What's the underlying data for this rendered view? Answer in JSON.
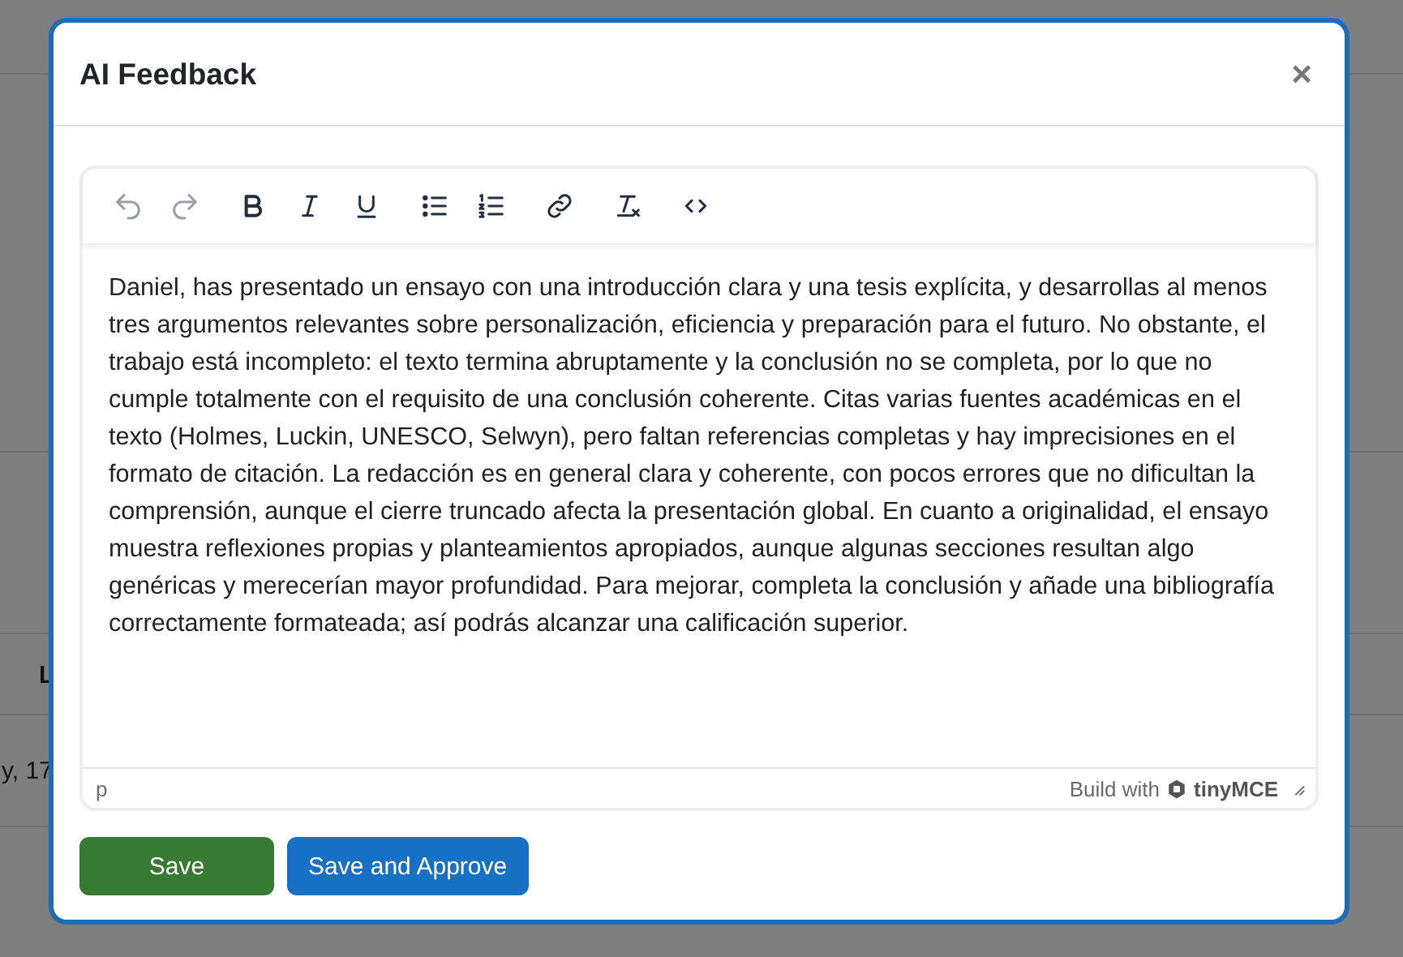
{
  "background": {
    "texts": [
      {
        "kind": "header",
        "text": "L"
      },
      {
        "kind": "cell",
        "text": "y, 17"
      }
    ]
  },
  "dialog": {
    "title": "AI Feedback",
    "close": "×"
  },
  "editor": {
    "toolbar": [
      {
        "kind": "undo",
        "disabled": true
      },
      {
        "kind": "redo",
        "disabled": true
      },
      {
        "kind": "bold",
        "disabled": false
      },
      {
        "kind": "italic",
        "disabled": false
      },
      {
        "kind": "underline",
        "disabled": false
      },
      {
        "kind": "bullet-list",
        "disabled": false
      },
      {
        "kind": "numbered-list",
        "disabled": false
      },
      {
        "kind": "link",
        "disabled": false
      },
      {
        "kind": "clear-format",
        "disabled": false
      },
      {
        "kind": "code",
        "disabled": false
      }
    ],
    "content": "Daniel, has presentado un ensayo con una introducción clara y una tesis explícita, y desarrollas al menos tres argumentos relevantes sobre personalización, eficiencia y preparación para el futuro. No obstante, el trabajo está incompleto: el texto termina abruptamente y la conclusión no se completa, por lo que no cumple totalmente con el requisito de una conclusión coherente. Citas varias fuentes académicas en el texto (Holmes, Luckin, UNESCO, Selwyn), pero faltan referencias completas y hay imprecisiones en el formato de citación. La redacción es en general clara y coherente, con pocos errores que no dificultan la comprensión, aunque el cierre truncado afecta la presentación global. En cuanto a originalidad, el ensayo muestra reflexiones propias y planteamientos apropiados, aunque algunas secciones resultan algo genéricas y merecerían mayor profundidad. Para mejorar, completa la conclusión y añade una bibliografía correctamente formateada; así podrás alcanzar una calificación superior.",
    "status_path": "p",
    "branding": "Build with",
    "brand": "tinyMCE"
  },
  "buttons": [
    {
      "kind": "save",
      "label": "Save"
    },
    {
      "kind": "approve",
      "label": "Save and Approve"
    }
  ]
}
